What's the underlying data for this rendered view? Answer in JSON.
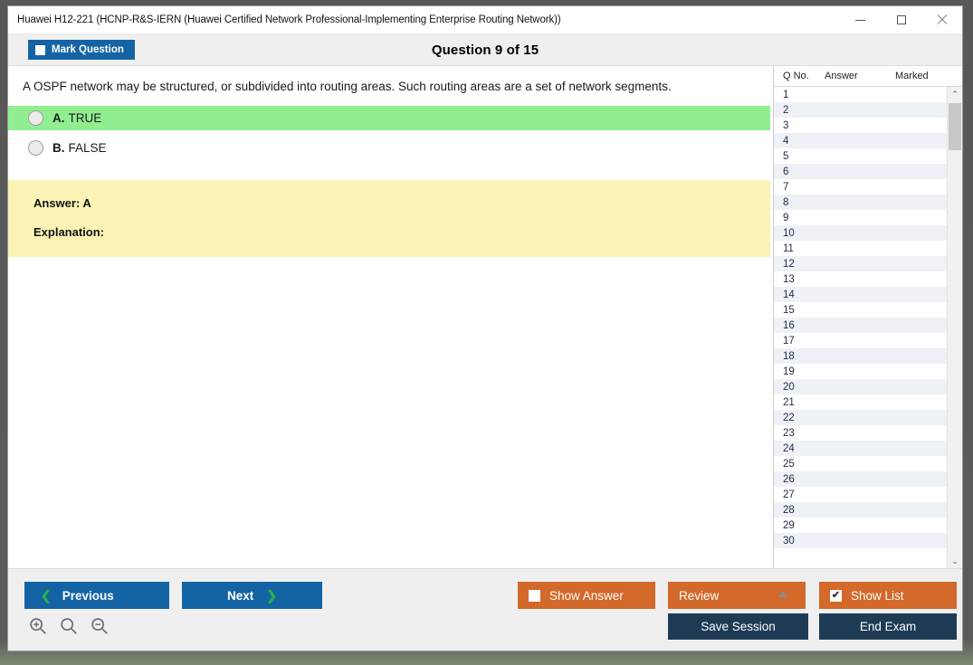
{
  "window": {
    "title": "Huawei H12-221 (HCNP-R&S-IERN (Huawei Certified Network Professional-Implementing Enterprise Routing Network))",
    "minimize_label": "Minimize",
    "maximize_label": "Maximize",
    "close_label": "Close"
  },
  "header": {
    "mark_question_label": "Mark Question",
    "mark_question_checked": false,
    "question_title": "Question 9 of 15"
  },
  "question": {
    "text": "A OSPF network may be structured, or subdivided into routing areas. Such routing areas are a set of network segments.",
    "options": [
      {
        "letter": "A.",
        "text": "TRUE",
        "correct": true
      },
      {
        "letter": "B.",
        "text": "FALSE",
        "correct": false
      }
    ]
  },
  "answer_panel": {
    "answer_label": "Answer: A",
    "explanation_label": "Explanation:"
  },
  "list_panel": {
    "columns": [
      "Q No.",
      "Answer",
      "Marked"
    ],
    "rows": [
      {
        "no": "1",
        "answer": "",
        "marked": ""
      },
      {
        "no": "2",
        "answer": "",
        "marked": ""
      },
      {
        "no": "3",
        "answer": "",
        "marked": ""
      },
      {
        "no": "4",
        "answer": "",
        "marked": ""
      },
      {
        "no": "5",
        "answer": "",
        "marked": ""
      },
      {
        "no": "6",
        "answer": "",
        "marked": ""
      },
      {
        "no": "7",
        "answer": "",
        "marked": ""
      },
      {
        "no": "8",
        "answer": "",
        "marked": ""
      },
      {
        "no": "9",
        "answer": "",
        "marked": ""
      },
      {
        "no": "10",
        "answer": "",
        "marked": ""
      },
      {
        "no": "11",
        "answer": "",
        "marked": ""
      },
      {
        "no": "12",
        "answer": "",
        "marked": ""
      },
      {
        "no": "13",
        "answer": "",
        "marked": ""
      },
      {
        "no": "14",
        "answer": "",
        "marked": ""
      },
      {
        "no": "15",
        "answer": "",
        "marked": ""
      },
      {
        "no": "16",
        "answer": "",
        "marked": ""
      },
      {
        "no": "17",
        "answer": "",
        "marked": ""
      },
      {
        "no": "18",
        "answer": "",
        "marked": ""
      },
      {
        "no": "19",
        "answer": "",
        "marked": ""
      },
      {
        "no": "20",
        "answer": "",
        "marked": ""
      },
      {
        "no": "21",
        "answer": "",
        "marked": ""
      },
      {
        "no": "22",
        "answer": "",
        "marked": ""
      },
      {
        "no": "23",
        "answer": "",
        "marked": ""
      },
      {
        "no": "24",
        "answer": "",
        "marked": ""
      },
      {
        "no": "25",
        "answer": "",
        "marked": ""
      },
      {
        "no": "26",
        "answer": "",
        "marked": ""
      },
      {
        "no": "27",
        "answer": "",
        "marked": ""
      },
      {
        "no": "28",
        "answer": "",
        "marked": ""
      },
      {
        "no": "29",
        "answer": "",
        "marked": ""
      },
      {
        "no": "30",
        "answer": "",
        "marked": ""
      }
    ],
    "scroll_up_glyph": "⌃",
    "scroll_down_glyph": "⌄"
  },
  "footer": {
    "previous_label": "Previous",
    "next_label": "Next",
    "previous_chevron": "❮",
    "next_chevron": "❯",
    "show_answer_label": "Show Answer",
    "show_answer_checked": false,
    "review_label": "Review",
    "show_list_label": "Show List",
    "show_list_checked": true,
    "show_list_check_glyph": "✔",
    "save_session_label": "Save Session",
    "end_exam_label": "End Exam",
    "zoom_in_label": "Zoom In",
    "zoom_reset_label": "Zoom Reset",
    "zoom_out_label": "Zoom Out"
  },
  "colors": {
    "accent_blue": "#1464a5",
    "accent_orange": "#d3692a",
    "accent_navy": "#1d3b54",
    "correct_green": "#90ee90",
    "answer_yellow": "#fbf3b5",
    "chevron_green": "#28b446"
  }
}
